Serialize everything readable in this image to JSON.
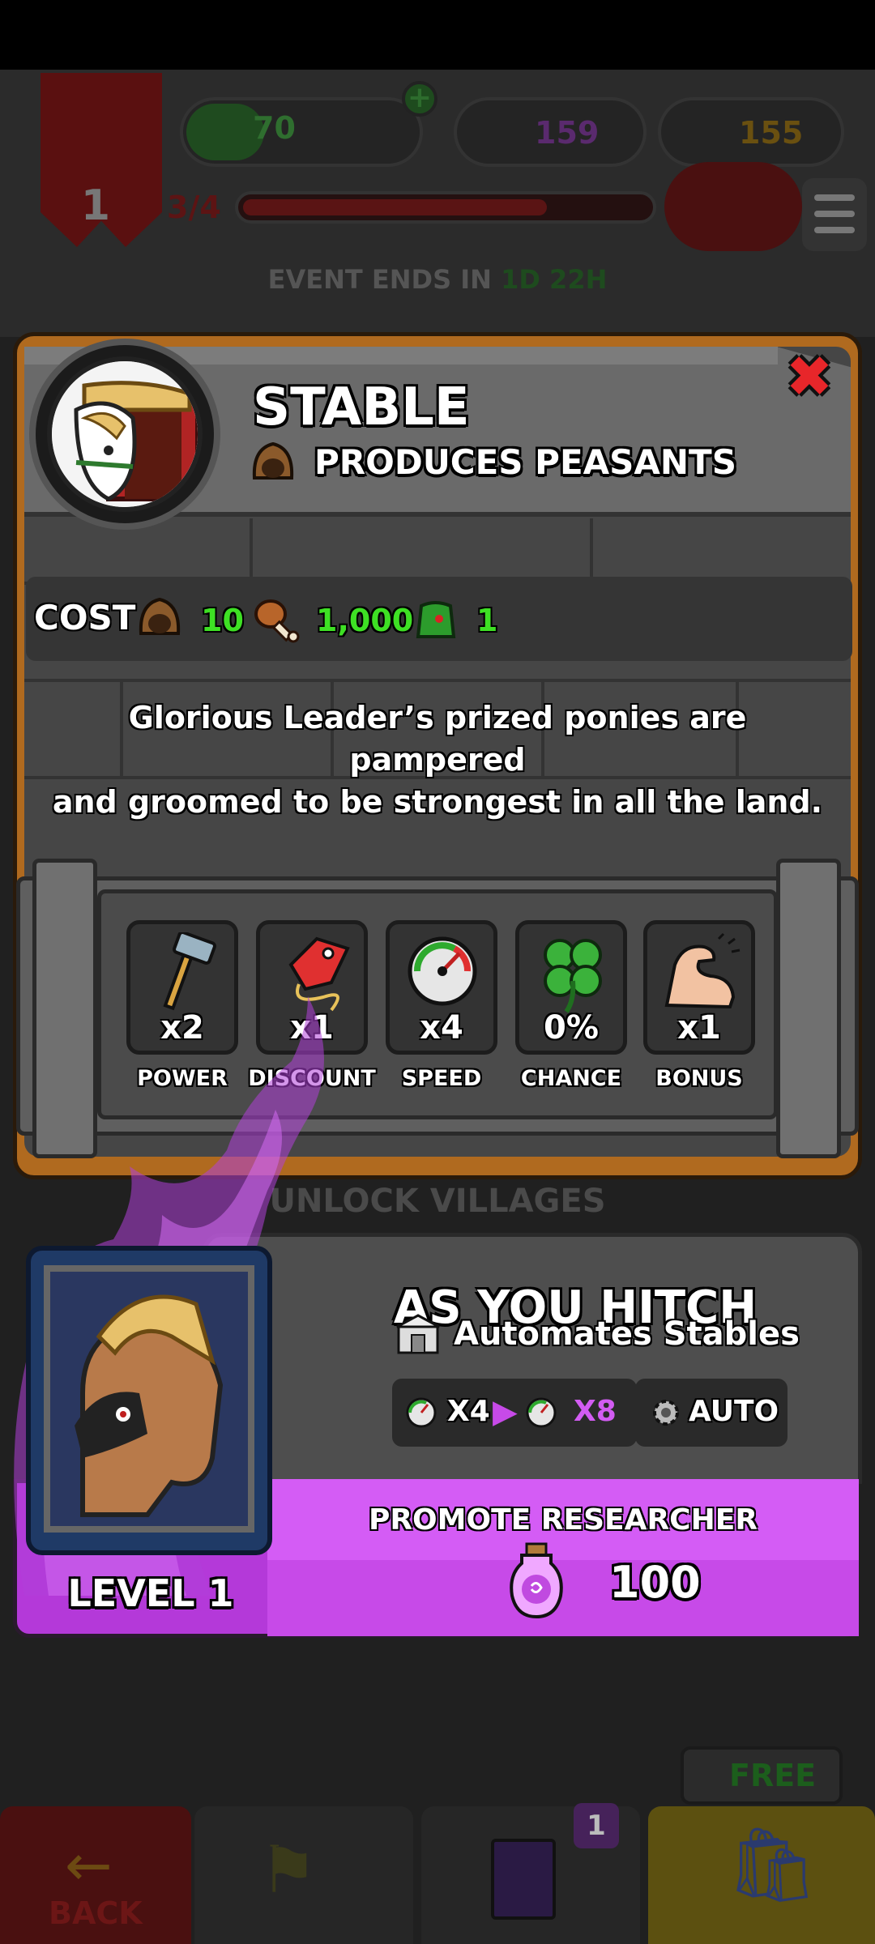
{
  "hud": {
    "banner_level": "1",
    "green_resource": "70",
    "purple_resource": "159",
    "gold_resource": "155",
    "progress_text": "3/4",
    "progress": 0.75
  },
  "event": {
    "prefix": "EVENT ENDS IN",
    "time": "1D 22H"
  },
  "building": {
    "title": "STABLE",
    "subtitle": "PRODUCES PEASANTS",
    "cost_label": "COST",
    "costs": [
      {
        "icon": "peasant-hood-icon",
        "value": "10"
      },
      {
        "icon": "meat-drumstick-icon",
        "value": "1,000"
      },
      {
        "icon": "green-hat-icon",
        "value": "1"
      }
    ],
    "description_line1": "Glorious Leader’s prized ponies are pampered",
    "description_line2": "and groomed to be strongest in all the land."
  },
  "stats": [
    {
      "icon": "hammer-icon",
      "mult": "x2",
      "label": "POWER"
    },
    {
      "icon": "price-tag-icon",
      "mult": "x1",
      "label": "DISCOUNT"
    },
    {
      "icon": "speedometer-icon",
      "mult": "x4",
      "label": "SPEED"
    },
    {
      "icon": "clover-icon",
      "mult": "0%",
      "label": "CHANCE"
    },
    {
      "icon": "flexed-arm-icon",
      "mult": "x1",
      "label": "BONUS"
    }
  ],
  "unlock_label": "UNLOCK VILLAGES",
  "researcher": {
    "name": "AS YOU HITCH",
    "automates": "Automates Stables",
    "speed_from": "X4",
    "speed_to": "X8",
    "auto_label": "AUTO",
    "level": "LEVEL 1",
    "promote_label": "PROMOTE RESEARCHER",
    "promote_cost": "100"
  },
  "nav": {
    "back_label": "BACK",
    "free_label": "FREE",
    "cards_badge": "1"
  },
  "colors": {
    "accent_purple": "#c74ae8",
    "cost_green": "#3ee024",
    "close_red": "#e8262a",
    "panel_wood": "#b06a1f"
  }
}
